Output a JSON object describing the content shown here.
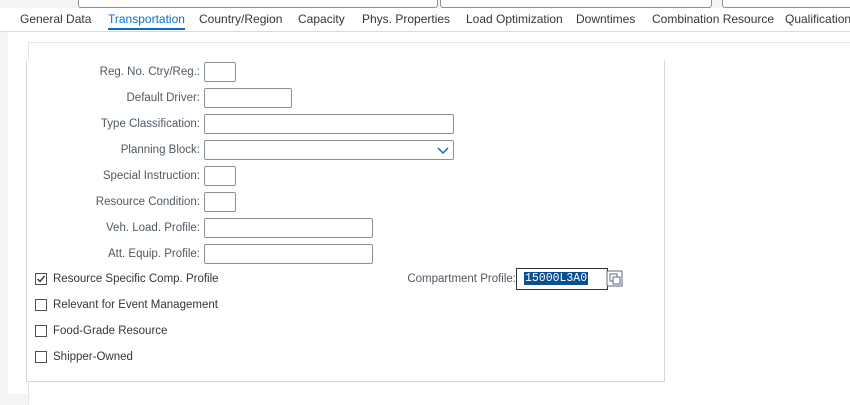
{
  "tabs": [
    {
      "label": "General Data"
    },
    {
      "label": "Transportation",
      "active": true
    },
    {
      "label": "Country/Region"
    },
    {
      "label": "Capacity"
    },
    {
      "label": "Phys. Properties"
    },
    {
      "label": "Load Optimization"
    },
    {
      "label": "Downtimes"
    },
    {
      "label": "Combination Resource"
    },
    {
      "label": "Qualification"
    }
  ],
  "fields": {
    "reg_no": {
      "label": "Reg. No. Ctry/Reg.:",
      "value": ""
    },
    "default_driver": {
      "label": "Default Driver:",
      "value": ""
    },
    "type_classification": {
      "label": "Type Classification:",
      "value": ""
    },
    "planning_block": {
      "label": "Planning Block:",
      "value": ""
    },
    "special_instruction": {
      "label": "Special Instruction:",
      "value": ""
    },
    "resource_condition": {
      "label": "Resource Condition:",
      "value": ""
    },
    "veh_load_profile": {
      "label": "Veh. Load. Profile:",
      "value": ""
    },
    "att_equip_profile": {
      "label": "Att. Equip. Profile:",
      "value": ""
    },
    "compartment_profile": {
      "label": "Compartment Profile:",
      "value": "15000L3A0"
    }
  },
  "checkboxes": [
    {
      "label": "Resource Specific Comp. Profile",
      "checked": true
    },
    {
      "label": "Relevant for Event Management",
      "checked": false
    },
    {
      "label": "Food-Grade Resource",
      "checked": false
    },
    {
      "label": "Shipper-Owned",
      "checked": false
    }
  ],
  "icons": {
    "select_chevron": "chevron-down-icon",
    "value_help": "value-help-icon",
    "checkbox_check": "check-icon"
  },
  "colors": {
    "accent": "#0a6ed1",
    "selection": "#0a4f94",
    "border": "#89919a"
  }
}
